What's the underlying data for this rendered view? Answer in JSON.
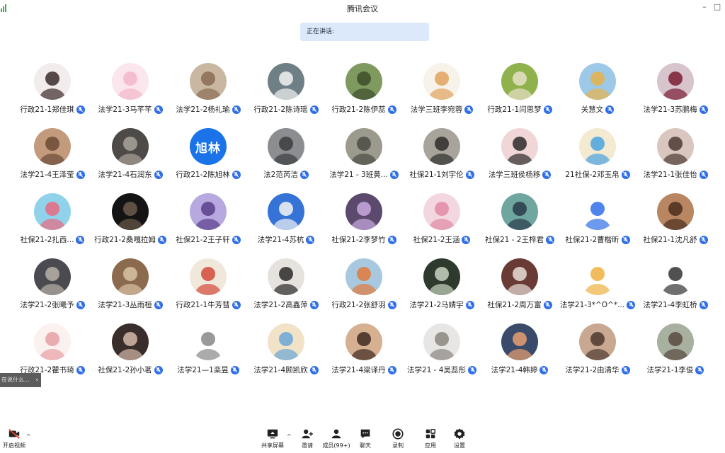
{
  "window": {
    "title": "腾讯会议"
  },
  "speaking": {
    "label": "正在讲话:"
  },
  "participants": [
    {
      "name": "行政21-1郑佳琪",
      "avatar": {
        "bg": "#f3ecec",
        "fg": "#3a2b2b"
      }
    },
    {
      "name": "法学21-3马芊芊",
      "avatar": {
        "bg": "#fbe6ee",
        "fg": "#f3b6c8"
      }
    },
    {
      "name": "法学21-2杨礼瑜",
      "avatar": {
        "bg": "#c9b7a2",
        "fg": "#8a6c54"
      }
    },
    {
      "name": "行政21-2陈诗瑶",
      "avatar": {
        "bg": "#6f7f86",
        "fg": "#f2f2f2"
      }
    },
    {
      "name": "行政21-2陈伊蕊",
      "avatar": {
        "bg": "#7f9a5e",
        "fg": "#3d4d2c"
      }
    },
    {
      "name": "法学三班李宛蓉",
      "avatar": {
        "bg": "#f7f2ea",
        "fg": "#e0a35c"
      }
    },
    {
      "name": "行政21-1闫思梦",
      "avatar": {
        "bg": "#8fb24c",
        "fg": "#e8dfc9"
      }
    },
    {
      "name": "关慧文",
      "avatar": {
        "bg": "#9dc9e8",
        "fg": "#e6b24a"
      }
    },
    {
      "name": "法学21-3苏鹏梅",
      "avatar": {
        "bg": "#d7c4cc",
        "fg": "#7a1e34"
      }
    },
    {
      "name": "法学21-4王泽莹",
      "avatar": {
        "bg": "#c49a7c",
        "fg": "#6b4a36"
      }
    },
    {
      "name": "法学21-4石润东",
      "avatar": {
        "bg": "#4d4a48",
        "fg": "#a9a39a"
      }
    },
    {
      "name": "行政21-2陈旭林",
      "avatar": {
        "bg": "#1a73e8",
        "fg": "#ffffff",
        "text": "旭林"
      }
    },
    {
      "name": "法2范芮洁",
      "avatar": {
        "bg": "#8b8d90",
        "fg": "#3b3d40"
      }
    },
    {
      "name": "法学21 - 3班黄...",
      "avatar": {
        "bg": "#9b9a8c",
        "fg": "#4d4c43"
      }
    },
    {
      "name": "社保21-1刘宇伦",
      "avatar": {
        "bg": "#a8a49c",
        "fg": "#2f2d2a"
      }
    },
    {
      "name": "法学三班侯杨移",
      "avatar": {
        "bg": "#f1d6d8",
        "fg": "#2d2a2a"
      }
    },
    {
      "name": "21社保-2邓玉帛",
      "avatar": {
        "bg": "#f4ead2",
        "fg": "#4aa3e0"
      }
    },
    {
      "name": "法学21-1张佳怡",
      "avatar": {
        "bg": "#d9c7bf",
        "fg": "#4b3a33"
      }
    },
    {
      "name": "社保21-2扎西...",
      "avatar": {
        "bg": "#8fd2ea",
        "fg": "#e86a80"
      }
    },
    {
      "name": "行政21-2桑嘎拉姆",
      "avatar": {
        "bg": "#141414",
        "fg": "#6b5a4a"
      }
    },
    {
      "name": "社保21-2王子轩",
      "avatar": {
        "bg": "#b7a8e0",
        "fg": "#5a3f8a"
      }
    },
    {
      "name": "法学21-4苏杭",
      "avatar": {
        "bg": "#3574d6",
        "fg": "#f4f4f4"
      }
    },
    {
      "name": "社保21-2李梦竹",
      "avatar": {
        "bg": "#5b4a6e",
        "fg": "#c9a8e0"
      }
    },
    {
      "name": "社保21-2王涵",
      "avatar": {
        "bg": "#f2d7e0",
        "fg": "#e38aa4"
      }
    },
    {
      "name": "社保21 - 2王梓君",
      "avatar": {
        "bg": "#6fa6a0",
        "fg": "#2a3a4a"
      }
    },
    {
      "name": "社保21-2曹楷昕",
      "avatar": {
        "bg": "#ffffff",
        "fg": "#2f6ee8"
      }
    },
    {
      "name": "社保21-1沈凡舒",
      "avatar": {
        "bg": "#b88762",
        "fg": "#4a2e1e"
      }
    },
    {
      "name": "法学21-2张曦予",
      "avatar": {
        "bg": "#4a4a50",
        "fg": "#b8b0a6"
      }
    },
    {
      "name": "法学21-3丛雨桓",
      "avatar": {
        "bg": "#8c6a4e",
        "fg": "#d8c2a4"
      }
    },
    {
      "name": "行政21-1牛芳彗",
      "avatar": {
        "bg": "#f1e8dc",
        "fg": "#d44a3a"
      }
    },
    {
      "name": "法学21-2高鑫萍",
      "avatar": {
        "bg": "#e6e2de",
        "fg": "#2a2a2a"
      }
    },
    {
      "name": "行政21-2张舒羽",
      "avatar": {
        "bg": "#a8c8e0",
        "fg": "#e07a3a"
      }
    },
    {
      "name": "法学21-2马婧宇",
      "avatar": {
        "bg": "#2e3a2e",
        "fg": "#c9d4c0"
      }
    },
    {
      "name": "社保21-2周万富",
      "avatar": {
        "bg": "#6a3a34",
        "fg": "#e8e0d8"
      }
    },
    {
      "name": "法学21-3*^O^*...",
      "avatar": {
        "bg": "#ffffff",
        "fg": "#f0b040"
      }
    },
    {
      "name": "法学21-4李虹桥",
      "avatar": {
        "bg": "#ffffff",
        "fg": "#333333"
      }
    },
    {
      "name": "行政21-2瞿书琦",
      "avatar": {
        "bg": "#fbf1ef",
        "fg": "#e8a0a4"
      }
    },
    {
      "name": "社保21-2孙小茗",
      "avatar": {
        "bg": "#3a2e2c",
        "fg": "#d6b8a8"
      }
    },
    {
      "name": "法学21—1栾昱",
      "avatar": {
        "bg": "#ffffff",
        "fg": "#888888"
      }
    },
    {
      "name": "法学21-4顾凯欣",
      "avatar": {
        "bg": "#f2e2c8",
        "fg": "#6aa6d6"
      }
    },
    {
      "name": "法学21-4梁译丹",
      "avatar": {
        "bg": "#d6b090",
        "fg": "#3e2a22"
      }
    },
    {
      "name": "法学21 - 4吴蕊彤",
      "avatar": {
        "bg": "#e8e6e4",
        "fg": "#8a8680"
      }
    },
    {
      "name": "法学21-4韩婷",
      "avatar": {
        "bg": "#3a4a6a",
        "fg": "#e8a070"
      }
    },
    {
      "name": "法学21-2由清华",
      "avatar": {
        "bg": "#c8a890",
        "fg": "#4e3a30"
      }
    },
    {
      "name": "法学21-1李俊",
      "avatar": {
        "bg": "#a8b0a0",
        "fg": "#5a4a40"
      }
    }
  ],
  "side_tab": {
    "label": "在说什么...",
    "chevron": "‹"
  },
  "toolbar": {
    "left": {
      "label": "开启视频",
      "icon": "video-off-icon"
    },
    "items": [
      {
        "label": "共享屏幕",
        "icon": "share-screen-icon"
      },
      {
        "label": "邀请",
        "icon": "invite-icon"
      },
      {
        "label": "成员(99+)",
        "icon": "members-icon"
      },
      {
        "label": "聊天",
        "icon": "chat-icon"
      },
      {
        "label": "录制",
        "icon": "record-icon"
      },
      {
        "label": "应用",
        "icon": "apps-icon"
      },
      {
        "label": "设置",
        "icon": "settings-icon"
      }
    ]
  },
  "colors": {
    "accent": "#2f6ee8",
    "speaking_bg": "#dce9fb",
    "recording_red": "#e8432f"
  }
}
